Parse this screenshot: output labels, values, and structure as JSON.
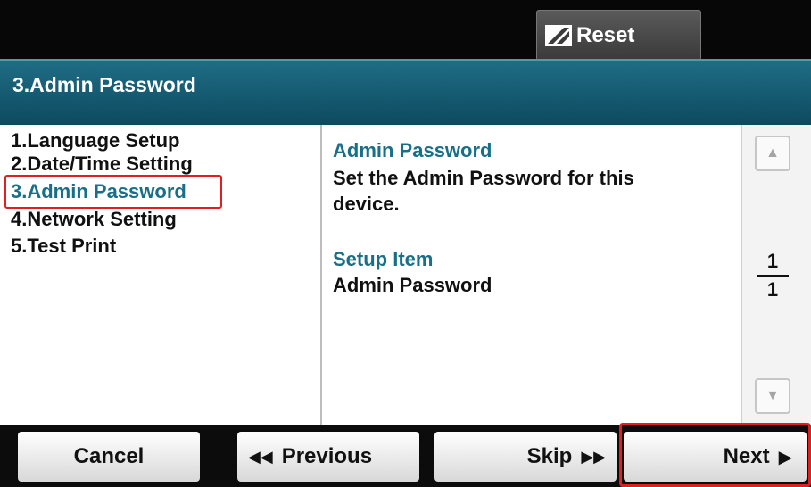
{
  "topbar": {
    "reset_label": "Reset",
    "reset_icon": "reset-eraser-icon"
  },
  "header": {
    "title": "3.Admin Password"
  },
  "menu": {
    "items": [
      {
        "label": "1.Language Setup"
      },
      {
        "label": "2.Date/Time Setting"
      },
      {
        "label": "3.Admin Password",
        "active": true
      },
      {
        "label": "4.Network Setting"
      },
      {
        "label": "5.Test Print"
      }
    ]
  },
  "info": {
    "section1_title": "Admin Password",
    "section1_line1": "Set the Admin Password for this",
    "section1_line2": "device.",
    "section2_title": "Setup Item",
    "section2_value": "Admin Password"
  },
  "pager": {
    "current": "1",
    "total": "1",
    "up_icon": "scroll-up-icon",
    "down_icon": "scroll-down-icon"
  },
  "buttons": {
    "cancel": "Cancel",
    "previous": "Previous",
    "skip": "Skip",
    "next": "Next"
  },
  "colors": {
    "accent": "#1a6f88",
    "highlight": "#e02020",
    "header": "#0d4a5e"
  }
}
